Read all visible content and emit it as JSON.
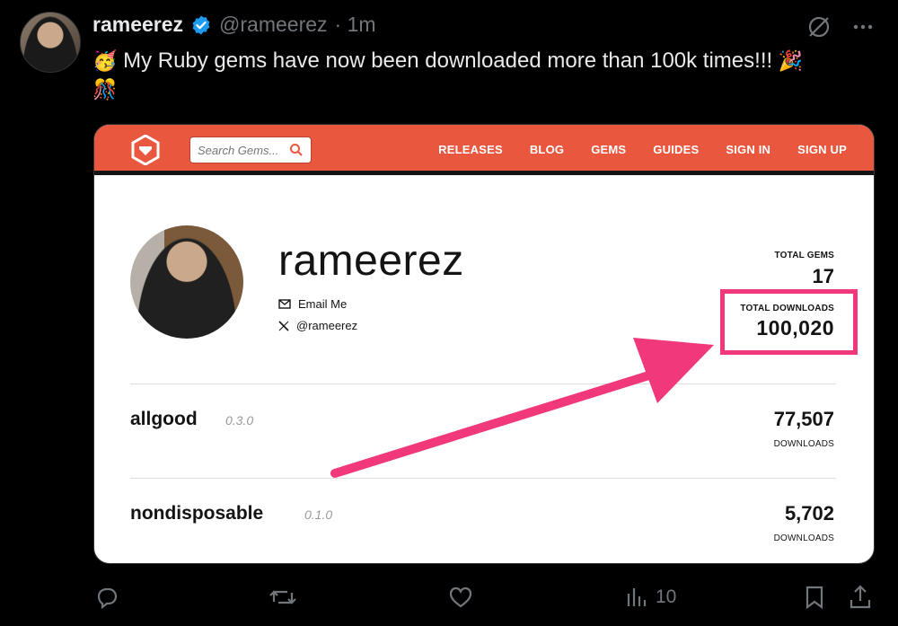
{
  "tweet": {
    "author_name": "rameerez",
    "handle": "@rameerez",
    "time": "· 1m",
    "text": "My Ruby gems have now been downloaded more than 100k times!!!",
    "views": "10"
  },
  "site": {
    "search_placeholder": "Search Gems...",
    "nav": [
      "RELEASES",
      "BLOG",
      "GEMS",
      "GUIDES",
      "SIGN IN",
      "SIGN UP"
    ]
  },
  "profile": {
    "username": "rameerez",
    "email_label": "Email Me",
    "x_handle": "@rameerez",
    "total_gems_label": "TOTAL GEMS",
    "total_gems": "17",
    "total_downloads_label": "TOTAL DOWNLOADS",
    "total_downloads": "100,020"
  },
  "gems": [
    {
      "name": "allgood",
      "version": "0.3.0",
      "downloads": "77,507",
      "downloads_label": "DOWNLOADS"
    },
    {
      "name": "nondisposable",
      "version": "0.1.0",
      "downloads": "5,702",
      "downloads_label": "DOWNLOADS"
    }
  ],
  "colors": {
    "navbar": "#e9573f",
    "highlight": "#f0387a",
    "verified": "#1d9bf0"
  }
}
